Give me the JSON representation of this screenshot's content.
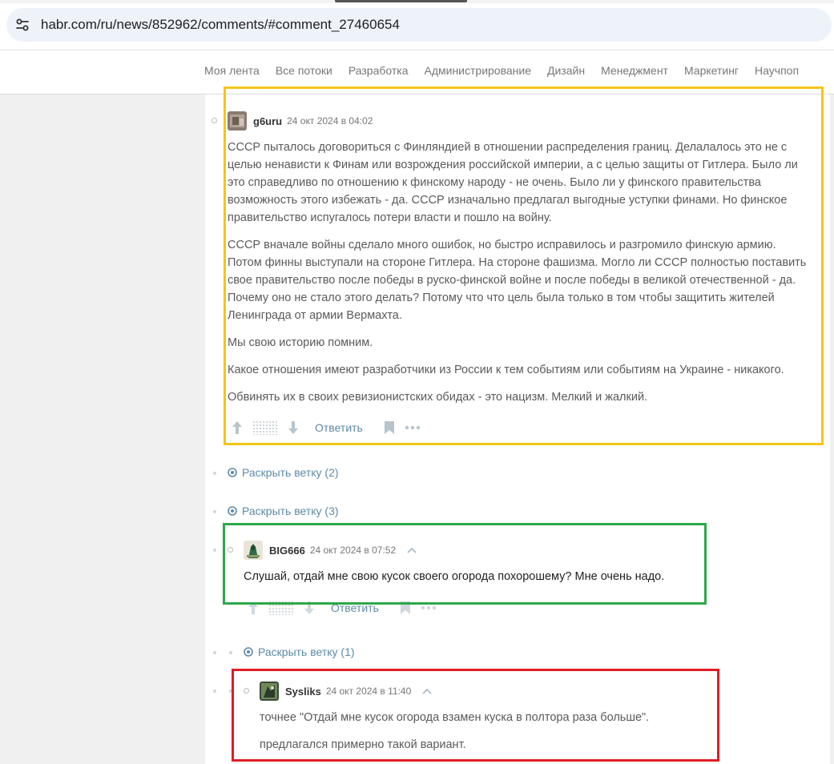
{
  "browser": {
    "url": "habr.com/ru/news/852962/comments/#comment_27460654"
  },
  "nav": {
    "items": [
      "Моя лента",
      "Все потоки",
      "Разработка",
      "Администрирование",
      "Дизайн",
      "Менеджмент",
      "Маркетинг",
      "Научпоп"
    ]
  },
  "comments": [
    {
      "username": "g6uru",
      "time": "24 окт 2024 в 04:02",
      "paragraphs": [
        "СССР пыталось договориться с Финляндией в отношении распределения границ. Делалалось это не с целью ненависти к Финам или возрождения российской империи, а с целью защиты от Гитлера. Было ли это справедливо по отношению к финскому народу - не очень. Было ли у финского правительства возможность этого избежать - да. СССР изначально предлагал выгодные уступки финами. Но финское правительство испугалось потери власти и пошло на войну.",
        "СССР вначале войны сделало много ошибок, но быстро исправилось и разгромило финскую армию. Потом финны выступали на стороне Гитлера. На стороне фашизма. Могло ли СССР полностью поставить свое правительство после победы в руско-финской войне и после победы в великой отечественной - да. Почему оно не стало этого делать? Потому что что цель была только в том чтобы защитить жителей Ленинграда от армии Вермахта.",
        "Мы свою историю помним.",
        "Какое отношения имеют разработчики из России к тем событиям или событиям на Украине - никакого.",
        "Обвинять их в своих ревизионистских обидах - это нацизм. Мелкий и жалкий."
      ],
      "reply_label": "Ответить"
    },
    {
      "username": "BIG666",
      "time": "24 окт 2024 в 07:52",
      "paragraphs": [
        "Слушай, отдай мне свою кусок своего огорода похорошему? Мне очень надо."
      ],
      "reply_label": "Ответить"
    },
    {
      "username": "Sysliks",
      "time": "24 окт 2024 в 11:40",
      "paragraphs": [
        "точнее \"Отдай мне кусок огорода взамен куска в полтора раза больше\".",
        "предлагался примерно такой вариант."
      ]
    }
  ],
  "branches": [
    {
      "label": "Раскрыть ветку (2)"
    },
    {
      "label": "Раскрыть ветку (3)"
    },
    {
      "label": "Раскрыть ветку (1)"
    }
  ],
  "colors": {
    "highlight_yellow": "#f5c518",
    "highlight_green": "#2ea84a",
    "highlight_red": "#e11d24",
    "link": "#5e8aa8"
  }
}
